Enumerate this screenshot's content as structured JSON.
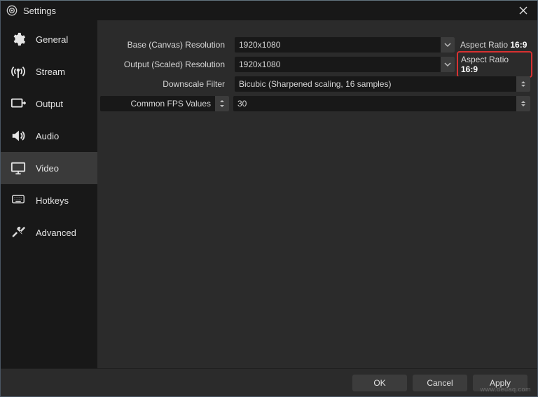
{
  "titlebar": {
    "title": "Settings"
  },
  "sidebar": {
    "items": [
      {
        "label": "General"
      },
      {
        "label": "Stream"
      },
      {
        "label": "Output"
      },
      {
        "label": "Audio"
      },
      {
        "label": "Video"
      },
      {
        "label": "Hotkeys"
      },
      {
        "label": "Advanced"
      }
    ]
  },
  "form": {
    "base_label": "Base (Canvas) Resolution",
    "base_value": "1920x1080",
    "base_aspect_label": "Aspect Ratio ",
    "base_aspect_value": "16:9",
    "output_label": "Output (Scaled) Resolution",
    "output_value": "1920x1080",
    "output_aspect_label": "Aspect Ratio ",
    "output_aspect_value": "16:9",
    "filter_label": "Downscale Filter",
    "filter_value": "Bicubic (Sharpened scaling, 16 samples)",
    "fps_label": "Common FPS Values",
    "fps_value": "30"
  },
  "footer": {
    "ok": "OK",
    "cancel": "Cancel",
    "apply": "Apply"
  },
  "watermark": "www.deuaq.com"
}
